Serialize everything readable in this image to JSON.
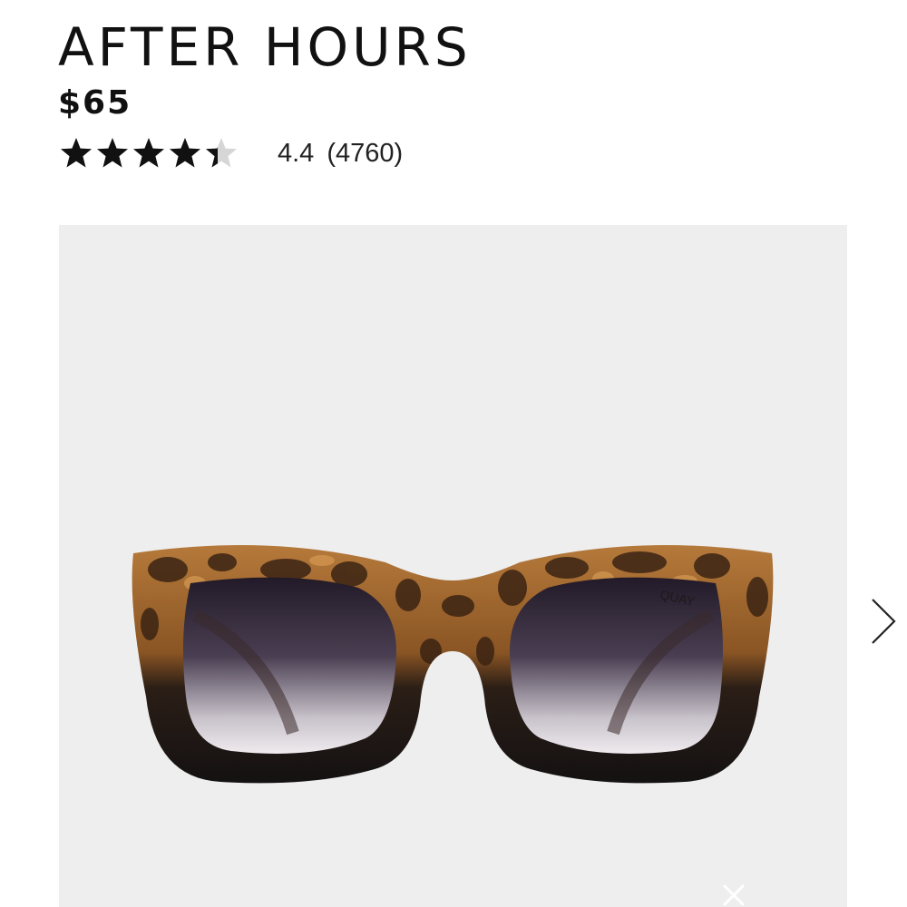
{
  "product": {
    "title": "AFTER HOURS",
    "price": "$65",
    "rating_value": "4.4",
    "review_count": "(4760)",
    "rating_fraction": 0.88
  },
  "image": {
    "brand_mark": "QUAY",
    "alt_description_icon": "sunglasses-product-image"
  },
  "carousel": {
    "next_icon": "chevron-right-icon",
    "close_icon": "close-icon"
  },
  "colors": {
    "text": "#111111",
    "gallery_bg": "#eeeeee",
    "star_filled": "#111111",
    "star_empty": "#d6d6d6"
  }
}
